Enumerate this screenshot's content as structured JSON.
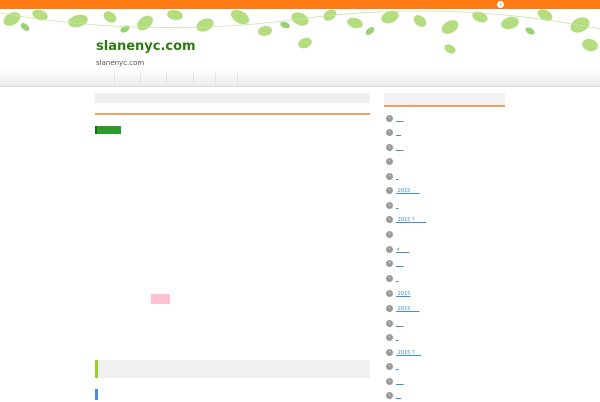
{
  "site": {
    "title": "slanenyc.com",
    "subtitle": "slanenyc.com"
  },
  "topbar": {
    "icon": "chevron-right-icon",
    "color": "#ff7a12"
  },
  "colors": {
    "accent": "#f0a060",
    "green": "#2d9a2d",
    "link": "#3a8fd6",
    "pink": "#ffc0cf"
  },
  "sidebar": {
    "items": [
      {
        "label": "___"
      },
      {
        "label": "__"
      },
      {
        "label": "___"
      },
      {
        "label": ""
      },
      {
        "label": "_"
      },
      {
        "label": " 2015 ___"
      },
      {
        "label": "_"
      },
      {
        "label": " 2015 ? ____"
      },
      {
        "label": ""
      },
      {
        "label": "× ___"
      },
      {
        "label": "___"
      },
      {
        "label": "_"
      },
      {
        "label": " 2015"
      },
      {
        "label": " 2015 ___"
      },
      {
        "label": "___"
      },
      {
        "label": "_"
      },
      {
        "label": " 2015 ? __"
      },
      {
        "label": "_"
      },
      {
        "label": "___"
      },
      {
        "label": "__"
      }
    ]
  }
}
